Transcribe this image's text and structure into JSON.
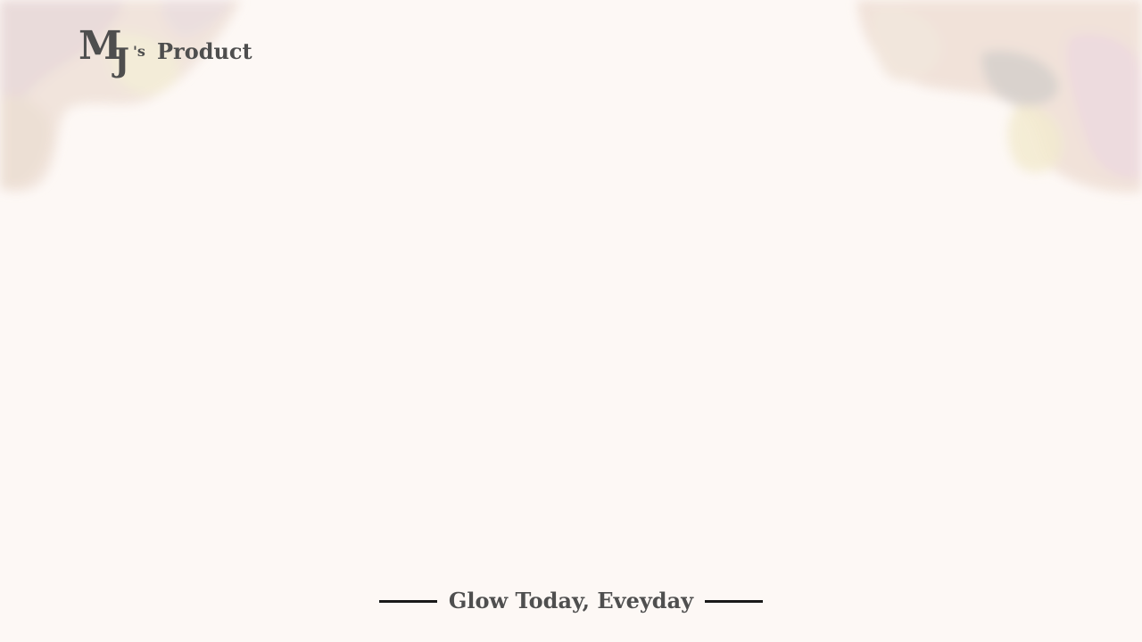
{
  "brand": {
    "m": "M",
    "j": "J",
    "apostrophe_s": "'s",
    "product": "Product"
  },
  "tagline": "Glow Today, Eveyday",
  "colors": {
    "background": "#fdf8f5",
    "text": "#4e4e4e",
    "rule": "#1a1a1a",
    "watercolor": [
      "#e9d3c6",
      "#d9c6cf",
      "#f0e6c8",
      "#cfc8c4"
    ]
  }
}
